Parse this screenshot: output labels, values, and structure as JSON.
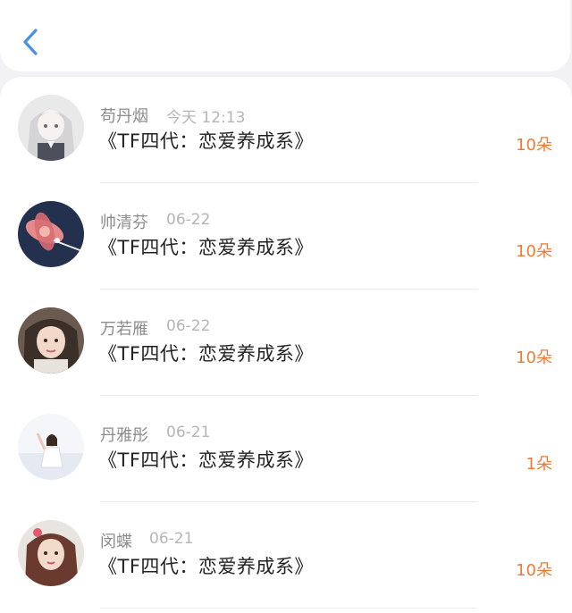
{
  "header": {
    "back_icon": "chevron-left-icon",
    "accent": "#4a90e2"
  },
  "colors": {
    "gift": "#f07a33",
    "name": "#8c8c8c",
    "date": "#b5b5b5",
    "title": "#222222"
  },
  "records": [
    {
      "name": "苟丹烟",
      "date": "今天 12:13",
      "book": "《TF四代：恋爱养成系》",
      "gift": "10朵"
    },
    {
      "name": "帅清芬",
      "date": "06-22",
      "book": "《TF四代：恋爱养成系》",
      "gift": "10朵"
    },
    {
      "name": "万若雁",
      "date": "06-22",
      "book": "《TF四代：恋爱养成系》",
      "gift": "10朵"
    },
    {
      "name": "丹雅彤",
      "date": "06-21",
      "book": "《TF四代：恋爱养成系》",
      "gift": "1朵"
    },
    {
      "name": "闵蝶",
      "date": "06-21",
      "book": "《TF四代：恋爱养成系》",
      "gift": "10朵"
    }
  ]
}
